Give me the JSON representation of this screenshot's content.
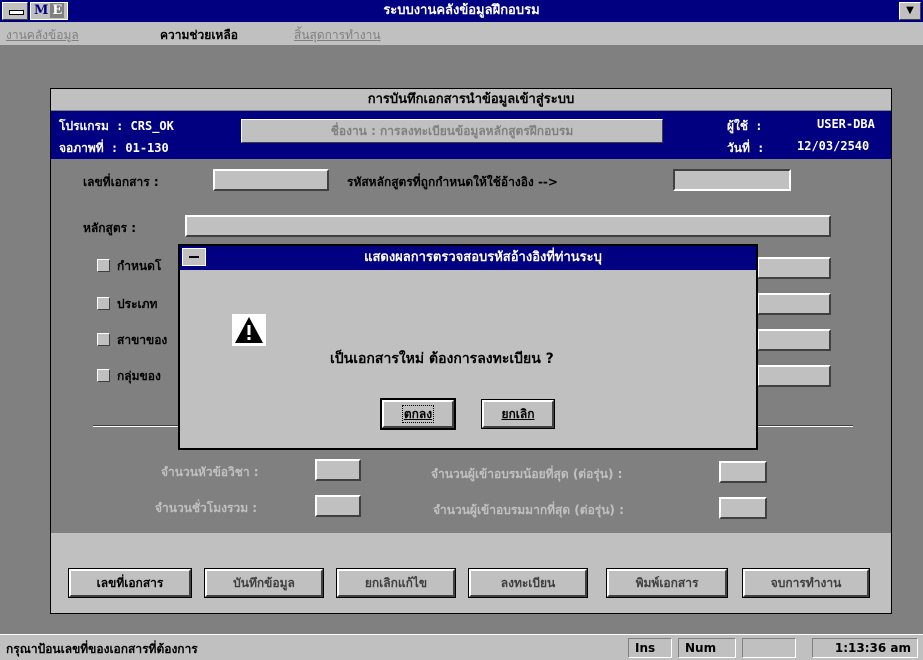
{
  "window": {
    "title": "ระบบงานคลังข้อมูลฝึกอบรม",
    "app_icon_text": "M",
    "app_icon_sub": "E",
    "scroll_glyph": "▼"
  },
  "menu": {
    "items": [
      {
        "label": "งานคลังข้อมูล",
        "enabled": false
      },
      {
        "label": "ความช่วยเหลือ",
        "enabled": true
      },
      {
        "label": "สิ้นสุดการทำงาน",
        "enabled": false
      }
    ]
  },
  "form": {
    "title": "การบันทึกเอกสารนำข้อมูลเข้าสู่ระบบ",
    "program_label": "โปรแกรม : CRS_OK",
    "screen_label": "จอภาพที่ : 01-130",
    "system_name": "ชื่องาน : การลงทะเบียนข้อมูลหลักสูตรฝึกอบรม",
    "user_label": "ผู้ใช้ :",
    "user_value": "USER-DBA",
    "date_label": "วันที่ :",
    "date_value": "12/03/2540",
    "doc_no_label": "เลขที่เอกสาร :",
    "ref_code_label": "รหัสหลักสูตรที่ถูกกำหนดให้ใช้อ้างอิง -->",
    "course_label": "หลักสูตร :",
    "check_labels": [
      "กำหนดโ",
      "ประเภท",
      "สาขาของ",
      "กลุ่มของ"
    ],
    "subject_count_label": "จำนวนหัวข้อวิชา :",
    "hours_total_label": "จำนวนชั่วโมงรวม :",
    "min_trainees_label": "จำนวนผู้เข้าอบรมน้อยที่สุด (ต่อรุ่น) :",
    "max_trainees_label": "จำนวนผู้เข้าอบรมมากที่สุด (ต่อรุ่น) :",
    "buttons": [
      "เลขที่เอกสาร",
      "บันทึกข้อมูล",
      "ยกเลิกแก้ไข",
      "ลงทะเบียน",
      "พิมพ์เอกสาร",
      "จบการทำงาน"
    ]
  },
  "dialog": {
    "title": "แสดงผลการตรวจสอบรหัสอ้างอิงที่ท่านระบุ",
    "message": "เป็นเอกสารใหม่  ต้องการลงทะเบียน ?",
    "ok_label": "ตกลง",
    "cancel_label": "ยกเลิก",
    "icon": "warning-icon"
  },
  "status": {
    "message": "กรุณาป้อนเลขที่ของเอกสารที่ต้องการ",
    "ins": "Ins",
    "num": "Num",
    "time": "1:13:36 am"
  },
  "colors": {
    "titlebar": "#000080",
    "face": "#c0c0c0",
    "desktop": "#808080"
  }
}
